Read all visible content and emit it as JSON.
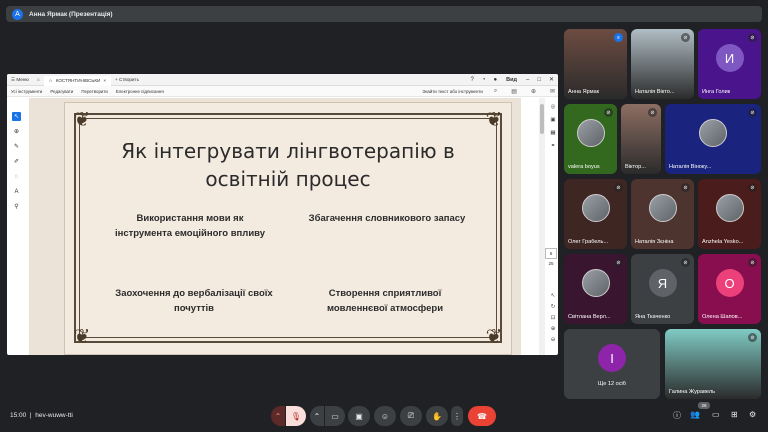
{
  "presenter_bar": {
    "avatar_letter": "A",
    "title": "Анна Ярмак (Презентація)"
  },
  "app": {
    "tabs": {
      "menu": "Меню",
      "doc_tab": "КОСТЯНТИНІВСЬКИ",
      "new_tab": "Створить"
    },
    "view_label": "Вид",
    "menu": {
      "all_tools": "Усі інструменти",
      "edit": "Редагувати",
      "convert": "Перетворити",
      "esign": "Електронне підписання",
      "search": "Знайти текст або інструменти"
    },
    "page": {
      "current": "5",
      "total": "25"
    }
  },
  "slide": {
    "title_line1": "Як інтегрувати лінгвотерапію в",
    "title_line2": "освітній процес",
    "bullets": [
      [
        "Використання мови як",
        "інструмента емоційного впливу"
      ],
      [
        "Збагачення словникового запасу"
      ],
      [
        "Заохочення  до вербалізації своїх",
        "почуттів"
      ],
      [
        "Створення сприятливої",
        "мовленнєвої атмосфери"
      ]
    ]
  },
  "participants": [
    {
      "name": "Анна Ярмак",
      "kind": "camera",
      "color": "#6d4c41",
      "mic": "speaking"
    },
    {
      "name": "Наталія Вікто...",
      "kind": "camera",
      "color": "#b0bec5",
      "mic": "muted"
    },
    {
      "name": "Инга Голик",
      "kind": "letter",
      "letter": "И",
      "color": "#4a148c",
      "bg": "#4a148c",
      "avatar_color": "#7e57c2",
      "mic": "muted"
    },
    {
      "name": "valera boyus",
      "kind": "photo",
      "bg": "#33691e",
      "mic": "muted"
    },
    {
      "name": "Віктор...",
      "kind": "camera",
      "color": "#8d6e63",
      "mic": "muted"
    },
    {
      "name": "Наталія Віноку...",
      "kind": "photo",
      "bg": "#1a237e",
      "mic": "muted"
    },
    {
      "name": "Олег Грабель...",
      "kind": "photo",
      "bg": "#3e2723",
      "mic": "muted"
    },
    {
      "name": "Наталія Зєніна",
      "kind": "photo",
      "bg": "#4e342e",
      "mic": "muted"
    },
    {
      "name": "Anzhela Yesko...",
      "kind": "photo",
      "bg": "#4a1c1c",
      "mic": "muted"
    },
    {
      "name": "Світлана Верл...",
      "kind": "photo",
      "bg": "#3a1530",
      "mic": "muted"
    },
    {
      "name": "Яна Ткаченко",
      "kind": "letter",
      "letter": "Я",
      "bg": "#3c4043",
      "avatar_color": "#5f6368",
      "mic": "muted"
    },
    {
      "name": "Олена Шапов...",
      "kind": "letter",
      "letter": "О",
      "bg": "#880e4f",
      "avatar_color": "#ec407a",
      "mic": "muted"
    },
    {
      "name": "Ще 12 осіб",
      "kind": "more",
      "letter": "І",
      "bg": "#3c4043",
      "avatar_color": "#8e24aa",
      "mic": "none"
    },
    {
      "name": "Галина Журавель",
      "kind": "camera",
      "color": "#80cbc4",
      "mic": "muted"
    }
  ],
  "bottom": {
    "time": "15:00",
    "separator": "|",
    "meeting_code": "hev-wuww-tti",
    "participants_count": "26"
  }
}
